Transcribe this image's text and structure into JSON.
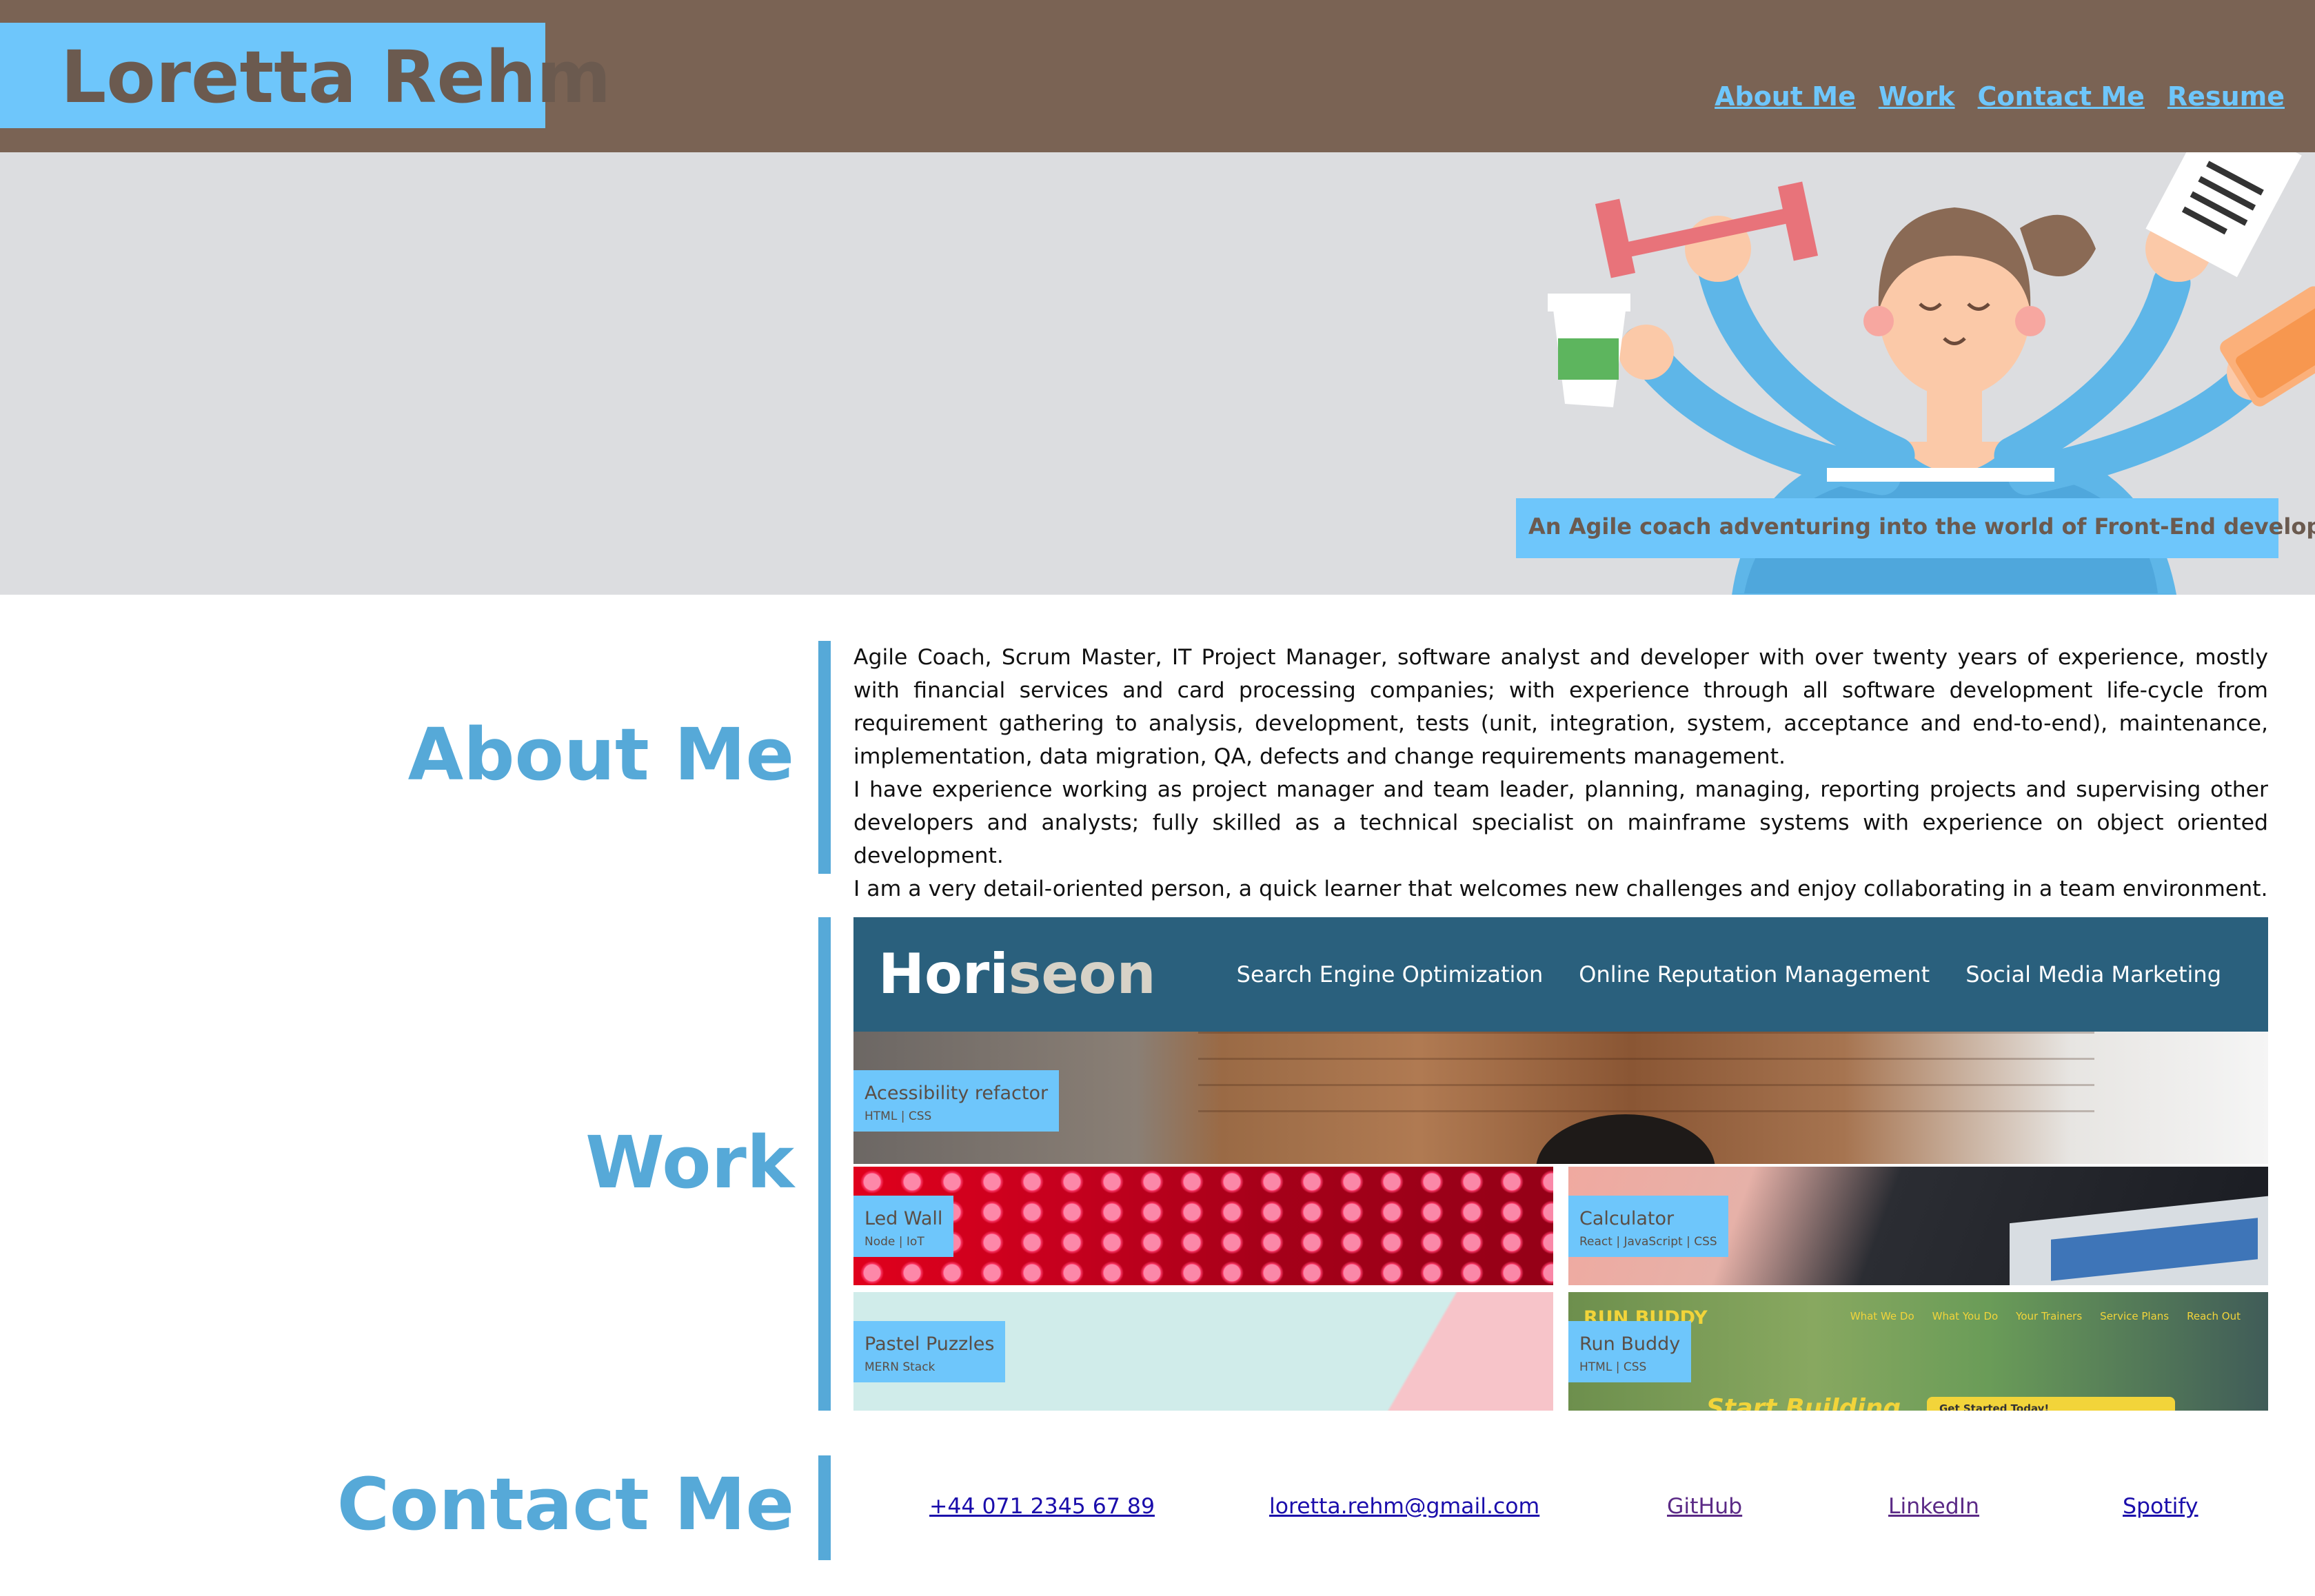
{
  "header": {
    "name": "Loretta Rehm",
    "nav": [
      "About Me",
      "Work",
      "Contact Me",
      "Resume"
    ]
  },
  "hero": {
    "tagline": "An Agile coach adventuring into the world of Front-End development..."
  },
  "about": {
    "title": "About Me",
    "paragraphs": [
      "Agile Coach, Scrum Master, IT Project Manager, software analyst and developer with over twenty years of experience, mostly with financial services and card processing companies; with experience through all software development life-cycle from requirement gathering to analysis, development, tests (unit, integration, system, acceptance and end-to-end), maintenance, implementation, data migration, QA, defects and change requirements management.",
      "I have experience working as project manager and team leader, planning, managing, reporting projects and supervising other developers and analysts; fully skilled as a technical specialist on mainframe systems with experience on object oriented development.",
      "I am a very detail-oriented person, a quick learner that welcomes new challenges and enjoy collaborating in a team environment."
    ]
  },
  "work": {
    "title": "Work",
    "featured": {
      "screenshot": {
        "logo_a": "Hori",
        "logo_b": "seon",
        "nav": [
          "Search Engine Optimization",
          "Online Reputation Management",
          "Social Media Marketing"
        ]
      },
      "title": "Acessibility refactor",
      "stack": "HTML | CSS"
    },
    "projects": [
      {
        "title": "Led Wall",
        "stack": "Node | IoT"
      },
      {
        "title": "Calculator",
        "stack": "React | JavaScript | CSS"
      },
      {
        "title": "Pastel Puzzles",
        "stack": "MERN Stack"
      },
      {
        "title": "Run Buddy",
        "stack": "HTML | CSS"
      }
    ],
    "runbuddy_screenshot": {
      "logo": "RUN BUDDY",
      "nav": [
        "What We Do",
        "What You Do",
        "Your Trainers",
        "Service Plans",
        "Reach Out"
      ],
      "hero": "Start Building",
      "button": "Get Started Today!"
    }
  },
  "contact": {
    "title": "Contact Me",
    "phone": "+44 071 2345 67 89",
    "email": "loretta.rehm@gmail.com",
    "github": "GitHub",
    "linkedin": "LinkedIn",
    "spotify": "Spotify"
  },
  "colors": {
    "header_bg": "#7a6354",
    "accent": "#6ec6fb",
    "section_title": "#56a9d8",
    "hero_bg": "#dcdde0",
    "horiseon_bar": "#2a607d"
  }
}
